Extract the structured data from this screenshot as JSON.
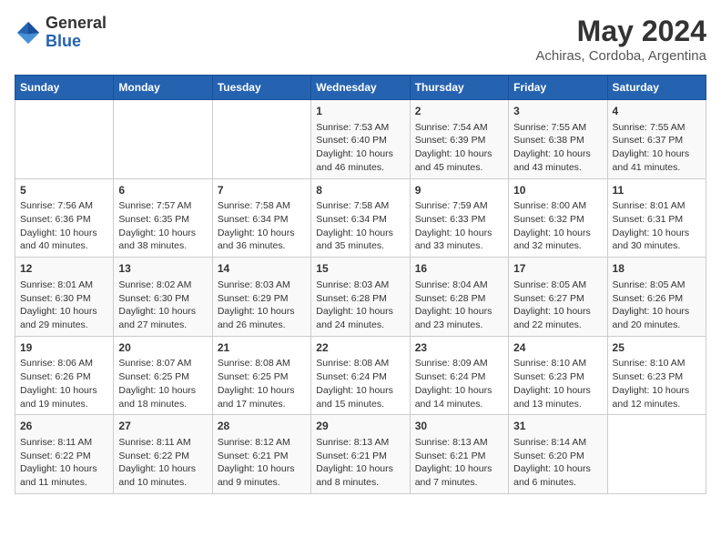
{
  "header": {
    "logo_line1": "General",
    "logo_line2": "Blue",
    "title": "May 2024",
    "subtitle": "Achiras, Cordoba, Argentina"
  },
  "days_of_week": [
    "Sunday",
    "Monday",
    "Tuesday",
    "Wednesday",
    "Thursday",
    "Friday",
    "Saturday"
  ],
  "weeks": [
    [
      {
        "day": "",
        "info": ""
      },
      {
        "day": "",
        "info": ""
      },
      {
        "day": "",
        "info": ""
      },
      {
        "day": "1",
        "info": "Sunrise: 7:53 AM\nSunset: 6:40 PM\nDaylight: 10 hours and 46 minutes."
      },
      {
        "day": "2",
        "info": "Sunrise: 7:54 AM\nSunset: 6:39 PM\nDaylight: 10 hours and 45 minutes."
      },
      {
        "day": "3",
        "info": "Sunrise: 7:55 AM\nSunset: 6:38 PM\nDaylight: 10 hours and 43 minutes."
      },
      {
        "day": "4",
        "info": "Sunrise: 7:55 AM\nSunset: 6:37 PM\nDaylight: 10 hours and 41 minutes."
      }
    ],
    [
      {
        "day": "5",
        "info": "Sunrise: 7:56 AM\nSunset: 6:36 PM\nDaylight: 10 hours and 40 minutes."
      },
      {
        "day": "6",
        "info": "Sunrise: 7:57 AM\nSunset: 6:35 PM\nDaylight: 10 hours and 38 minutes."
      },
      {
        "day": "7",
        "info": "Sunrise: 7:58 AM\nSunset: 6:34 PM\nDaylight: 10 hours and 36 minutes."
      },
      {
        "day": "8",
        "info": "Sunrise: 7:58 AM\nSunset: 6:34 PM\nDaylight: 10 hours and 35 minutes."
      },
      {
        "day": "9",
        "info": "Sunrise: 7:59 AM\nSunset: 6:33 PM\nDaylight: 10 hours and 33 minutes."
      },
      {
        "day": "10",
        "info": "Sunrise: 8:00 AM\nSunset: 6:32 PM\nDaylight: 10 hours and 32 minutes."
      },
      {
        "day": "11",
        "info": "Sunrise: 8:01 AM\nSunset: 6:31 PM\nDaylight: 10 hours and 30 minutes."
      }
    ],
    [
      {
        "day": "12",
        "info": "Sunrise: 8:01 AM\nSunset: 6:30 PM\nDaylight: 10 hours and 29 minutes."
      },
      {
        "day": "13",
        "info": "Sunrise: 8:02 AM\nSunset: 6:30 PM\nDaylight: 10 hours and 27 minutes."
      },
      {
        "day": "14",
        "info": "Sunrise: 8:03 AM\nSunset: 6:29 PM\nDaylight: 10 hours and 26 minutes."
      },
      {
        "day": "15",
        "info": "Sunrise: 8:03 AM\nSunset: 6:28 PM\nDaylight: 10 hours and 24 minutes."
      },
      {
        "day": "16",
        "info": "Sunrise: 8:04 AM\nSunset: 6:28 PM\nDaylight: 10 hours and 23 minutes."
      },
      {
        "day": "17",
        "info": "Sunrise: 8:05 AM\nSunset: 6:27 PM\nDaylight: 10 hours and 22 minutes."
      },
      {
        "day": "18",
        "info": "Sunrise: 8:05 AM\nSunset: 6:26 PM\nDaylight: 10 hours and 20 minutes."
      }
    ],
    [
      {
        "day": "19",
        "info": "Sunrise: 8:06 AM\nSunset: 6:26 PM\nDaylight: 10 hours and 19 minutes."
      },
      {
        "day": "20",
        "info": "Sunrise: 8:07 AM\nSunset: 6:25 PM\nDaylight: 10 hours and 18 minutes."
      },
      {
        "day": "21",
        "info": "Sunrise: 8:08 AM\nSunset: 6:25 PM\nDaylight: 10 hours and 17 minutes."
      },
      {
        "day": "22",
        "info": "Sunrise: 8:08 AM\nSunset: 6:24 PM\nDaylight: 10 hours and 15 minutes."
      },
      {
        "day": "23",
        "info": "Sunrise: 8:09 AM\nSunset: 6:24 PM\nDaylight: 10 hours and 14 minutes."
      },
      {
        "day": "24",
        "info": "Sunrise: 8:10 AM\nSunset: 6:23 PM\nDaylight: 10 hours and 13 minutes."
      },
      {
        "day": "25",
        "info": "Sunrise: 8:10 AM\nSunset: 6:23 PM\nDaylight: 10 hours and 12 minutes."
      }
    ],
    [
      {
        "day": "26",
        "info": "Sunrise: 8:11 AM\nSunset: 6:22 PM\nDaylight: 10 hours and 11 minutes."
      },
      {
        "day": "27",
        "info": "Sunrise: 8:11 AM\nSunset: 6:22 PM\nDaylight: 10 hours and 10 minutes."
      },
      {
        "day": "28",
        "info": "Sunrise: 8:12 AM\nSunset: 6:21 PM\nDaylight: 10 hours and 9 minutes."
      },
      {
        "day": "29",
        "info": "Sunrise: 8:13 AM\nSunset: 6:21 PM\nDaylight: 10 hours and 8 minutes."
      },
      {
        "day": "30",
        "info": "Sunrise: 8:13 AM\nSunset: 6:21 PM\nDaylight: 10 hours and 7 minutes."
      },
      {
        "day": "31",
        "info": "Sunrise: 8:14 AM\nSunset: 6:20 PM\nDaylight: 10 hours and 6 minutes."
      },
      {
        "day": "",
        "info": ""
      }
    ]
  ]
}
